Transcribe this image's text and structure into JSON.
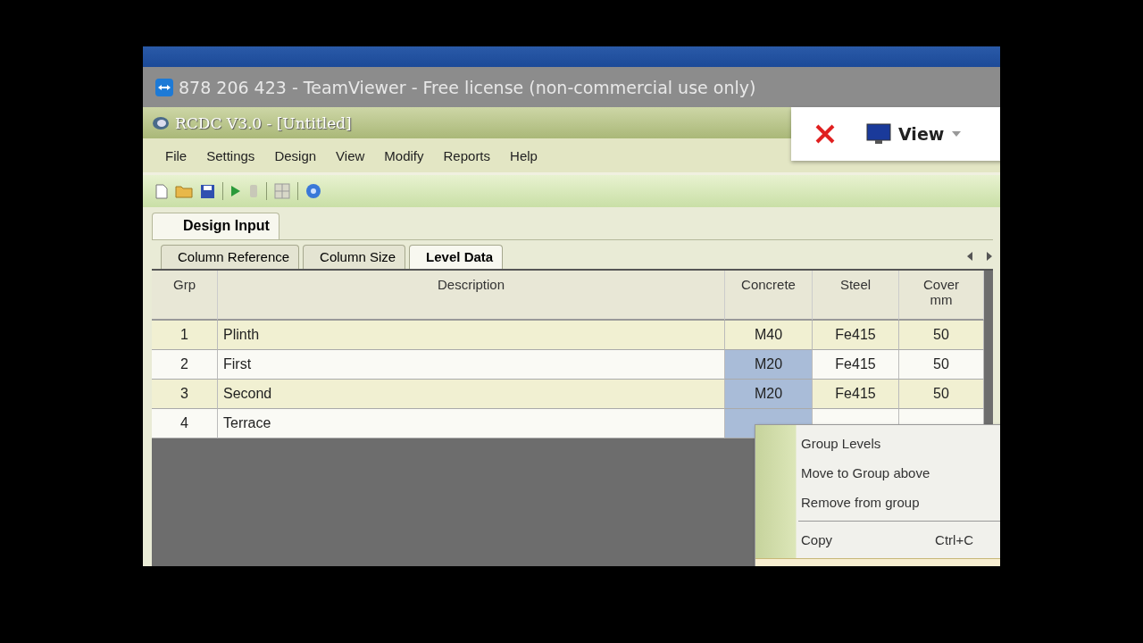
{
  "remote_window": {
    "title": "878 206 423 - TeamViewer - Free license (non-commercial use only)",
    "panel_button": "View"
  },
  "app": {
    "title": "RCDC V3.0 - [Untitled]",
    "menu": [
      "File",
      "Settings",
      "Design",
      "View",
      "Modify",
      "Reports",
      "Help"
    ],
    "tabs": [
      {
        "label": "Design Input",
        "selected": true
      }
    ],
    "subtabs": [
      {
        "label": "Column Reference",
        "selected": false
      },
      {
        "label": "Column Size",
        "selected": false
      },
      {
        "label": "Level Data",
        "selected": true
      }
    ],
    "table": {
      "columns": [
        "Grp",
        "Description",
        "Concrete",
        "Steel",
        "Cover\nmm"
      ],
      "rows": [
        {
          "grp": "1",
          "description": "Plinth",
          "concrete": "M40",
          "steel": "Fe415",
          "cover": "50",
          "concrete_selected": false
        },
        {
          "grp": "2",
          "description": "First",
          "concrete": "M20",
          "steel": "Fe415",
          "cover": "50",
          "concrete_selected": true
        },
        {
          "grp": "3",
          "description": "Second",
          "concrete": "M20",
          "steel": "Fe415",
          "cover": "50",
          "concrete_selected": true
        },
        {
          "grp": "4",
          "description": "Terrace",
          "concrete_selected": true
        }
      ]
    },
    "context_menu": [
      {
        "kind": "item",
        "label": "Group Levels"
      },
      {
        "kind": "item",
        "label": "Move to Group above"
      },
      {
        "kind": "item",
        "label": "Remove from group"
      },
      {
        "kind": "separator"
      },
      {
        "kind": "item",
        "label": "Copy",
        "shortcut": "Ctrl+C"
      }
    ]
  }
}
